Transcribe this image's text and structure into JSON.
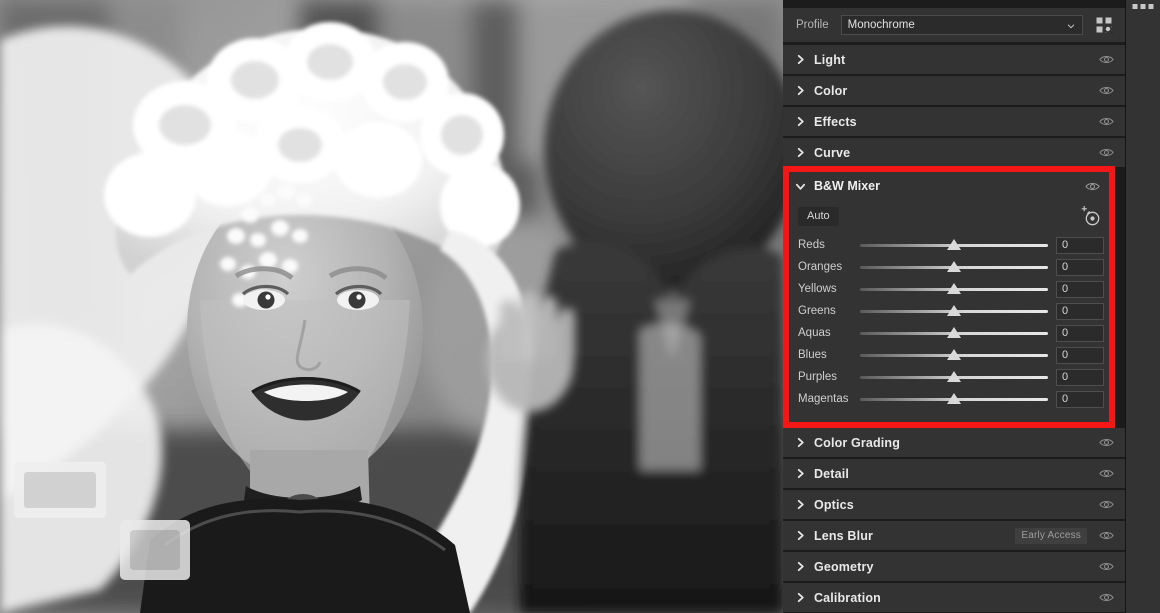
{
  "app": {
    "theme_bg": "#333333",
    "accent_highlight": "#f51616",
    "panel_divider": "#1c1c1c"
  },
  "photo": {
    "alt": "Black and white portrait of a smiling woman wearing an ornate white lace and flower headdress, with a man's head out of focus in the foreground",
    "mode": "monochrome"
  },
  "right_rail": {
    "overflow_icon": "more-dots-icon",
    "dots": 3
  },
  "profile": {
    "label": "Profile",
    "value": "Monochrome",
    "placeholder": "Monochrome",
    "dropdown_icon": "chevron-down-icon",
    "browse_icon": "profile-browser-icon"
  },
  "sections": [
    {
      "label": "Light",
      "expanded": false,
      "chevron": "chevron-right-icon",
      "eye": "eye-icon",
      "badge": null
    },
    {
      "label": "Color",
      "expanded": false,
      "chevron": "chevron-right-icon",
      "eye": "eye-icon",
      "badge": null
    },
    {
      "label": "Effects",
      "expanded": false,
      "chevron": "chevron-right-icon",
      "eye": "eye-icon",
      "badge": null
    },
    {
      "label": "Curve",
      "expanded": false,
      "chevron": "chevron-right-icon",
      "eye": "eye-icon",
      "badge": null
    }
  ],
  "sections_below": [
    {
      "label": "Color Grading",
      "expanded": false,
      "chevron": "chevron-right-icon",
      "eye": "eye-icon",
      "badge": null
    },
    {
      "label": "Detail",
      "expanded": false,
      "chevron": "chevron-right-icon",
      "eye": "eye-icon",
      "badge": null
    },
    {
      "label": "Optics",
      "expanded": false,
      "chevron": "chevron-right-icon",
      "eye": "eye-icon",
      "badge": null
    },
    {
      "label": "Lens Blur",
      "expanded": false,
      "chevron": "chevron-right-icon",
      "eye": "eye-icon",
      "badge": "Early Access"
    },
    {
      "label": "Geometry",
      "expanded": false,
      "chevron": "chevron-right-icon",
      "eye": "eye-icon",
      "badge": null
    },
    {
      "label": "Calibration",
      "expanded": false,
      "chevron": "chevron-right-icon",
      "eye": "eye-icon",
      "badge": null
    }
  ],
  "bw_mixer": {
    "title": "B&W Mixer",
    "expanded": true,
    "chevron": "chevron-down-icon",
    "eye": "eye-icon",
    "auto_label": "Auto",
    "target_tool_icon": "target-adjustment-icon",
    "highlighted": true,
    "slider_min": -100,
    "slider_max": 100,
    "sliders": [
      {
        "label": "Reds",
        "value": "0",
        "percent": 50
      },
      {
        "label": "Oranges",
        "value": "0",
        "percent": 50
      },
      {
        "label": "Yellows",
        "value": "0",
        "percent": 50
      },
      {
        "label": "Greens",
        "value": "0",
        "percent": 50
      },
      {
        "label": "Aquas",
        "value": "0",
        "percent": 50
      },
      {
        "label": "Blues",
        "value": "0",
        "percent": 50
      },
      {
        "label": "Purples",
        "value": "0",
        "percent": 50
      },
      {
        "label": "Magentas",
        "value": "0",
        "percent": 50
      }
    ]
  }
}
